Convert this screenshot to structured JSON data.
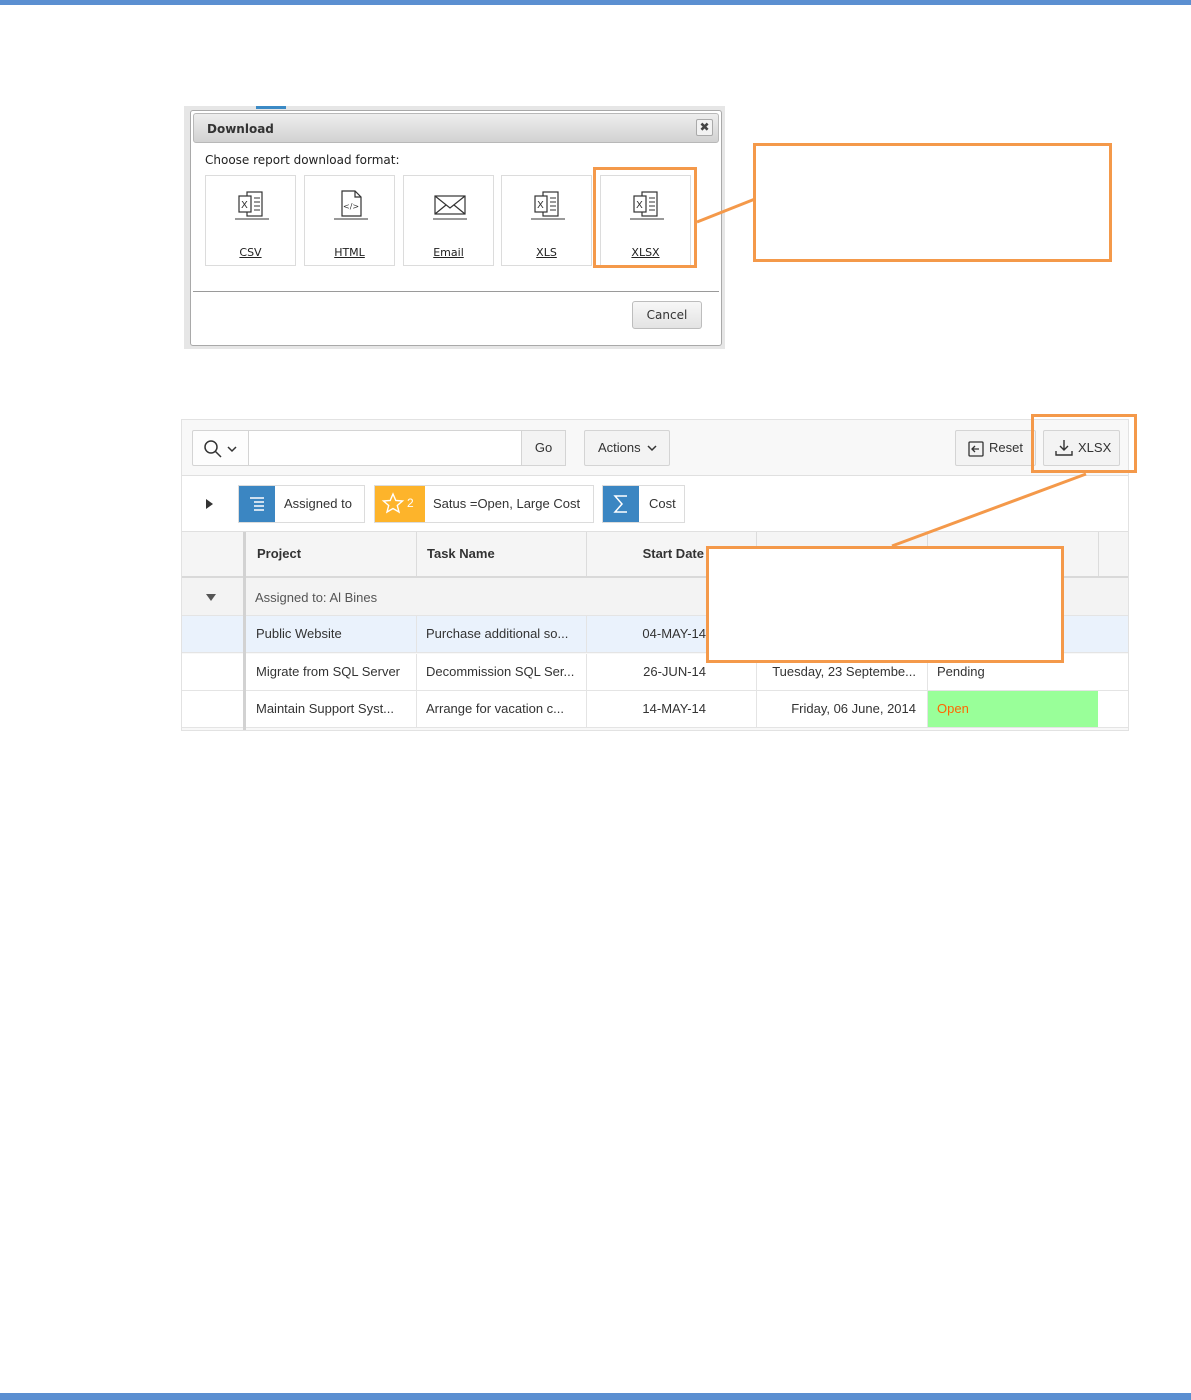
{
  "dialog": {
    "title": "Download",
    "close_glyph": "✖",
    "prompt": "Choose report download format:",
    "formats": [
      {
        "label": "CSV",
        "icon": "excel-file-icon"
      },
      {
        "label": "HTML",
        "icon": "html-file-icon"
      },
      {
        "label": "Email",
        "icon": "email-envelope-icon"
      },
      {
        "label": "XLS",
        "icon": "excel-file-icon"
      },
      {
        "label": "XLSX",
        "icon": "excel-file-icon"
      }
    ],
    "cancel_label": "Cancel"
  },
  "grid": {
    "toolbar": {
      "go_label": "Go",
      "actions_label": "Actions",
      "reset_label": "Reset",
      "download_label": "XLSX"
    },
    "filters": [
      {
        "label": "Assigned to",
        "icon": "control-break-icon",
        "color": "#3b86c2"
      },
      {
        "badge": "2",
        "label": "Satus =Open, Large Cost",
        "icon": "star-icon",
        "color": "#fdb42b"
      },
      {
        "label": "Cost",
        "icon": "sigma-icon",
        "color": "#3b86c2"
      }
    ],
    "columns": [
      "Project",
      "Task Name",
      "Start Date"
    ],
    "group_label": "Assigned to: Al Bines",
    "rows": [
      {
        "project": "Public Website",
        "task": "Purchase additional so...",
        "start": "04-MAY-14",
        "end": "",
        "status": ""
      },
      {
        "project": "Migrate from SQL Server",
        "task": "Decommission SQL Ser...",
        "start": "26-JUN-14",
        "end": "Tuesday, 23 Septembe...",
        "status": "Pending"
      },
      {
        "project": "Maintain Support Syst...",
        "task": "Arrange for vacation c...",
        "start": "14-MAY-14",
        "end": "Friday, 06 June, 2014",
        "status": "Open"
      }
    ]
  },
  "colors": {
    "callout": "#f4994a",
    "page_border": "#5b8fd1",
    "open_status_bg": "#99ff99",
    "open_status_text": "#ff6600"
  }
}
